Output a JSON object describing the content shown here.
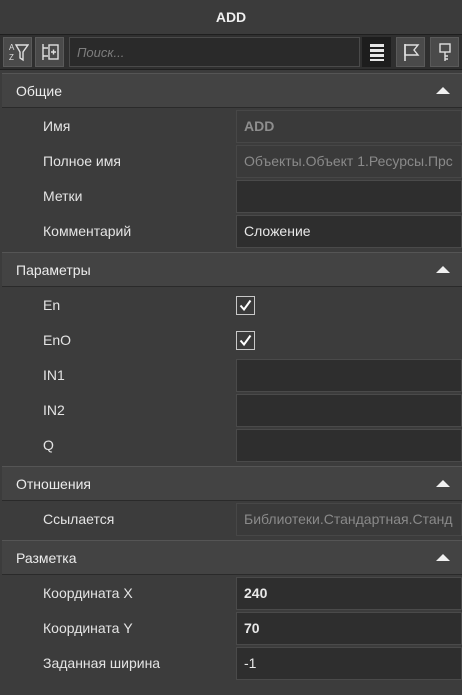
{
  "window": {
    "title": "ADD"
  },
  "toolbar": {
    "search_placeholder": "Поиск...",
    "buttons": [
      {
        "icon": "sort-az-filter-icon"
      },
      {
        "icon": "collapse-tree-icon"
      },
      {
        "icon": "list-view-icon",
        "active": true
      },
      {
        "icon": "flag-icon"
      },
      {
        "icon": "key-icon"
      }
    ]
  },
  "sections": {
    "general": {
      "title": "Общие",
      "rows": [
        {
          "label": "Имя",
          "value": "ADD"
        },
        {
          "label": "Полное имя",
          "value": "Объекты.Объект 1.Ресурсы.Прс"
        },
        {
          "label": "Метки",
          "value": ""
        },
        {
          "label": "Комментарий",
          "value": "Сложение"
        }
      ]
    },
    "params": {
      "title": "Параметры",
      "rows": [
        {
          "label": "En",
          "checked": true
        },
        {
          "label": "EnO",
          "checked": true
        },
        {
          "label": "IN1",
          "value": ""
        },
        {
          "label": "IN2",
          "value": ""
        },
        {
          "label": "Q",
          "value": ""
        }
      ]
    },
    "relations": {
      "title": "Отношения",
      "rows": [
        {
          "label": "Ссылается",
          "value": "Библиотеки.Стандартная.Станд"
        }
      ]
    },
    "layout": {
      "title": "Разметка",
      "rows": [
        {
          "label": "Координата X",
          "value": "240"
        },
        {
          "label": "Координата Y",
          "value": "70"
        },
        {
          "label": "Заданная ширина",
          "value": "-1"
        }
      ]
    }
  }
}
